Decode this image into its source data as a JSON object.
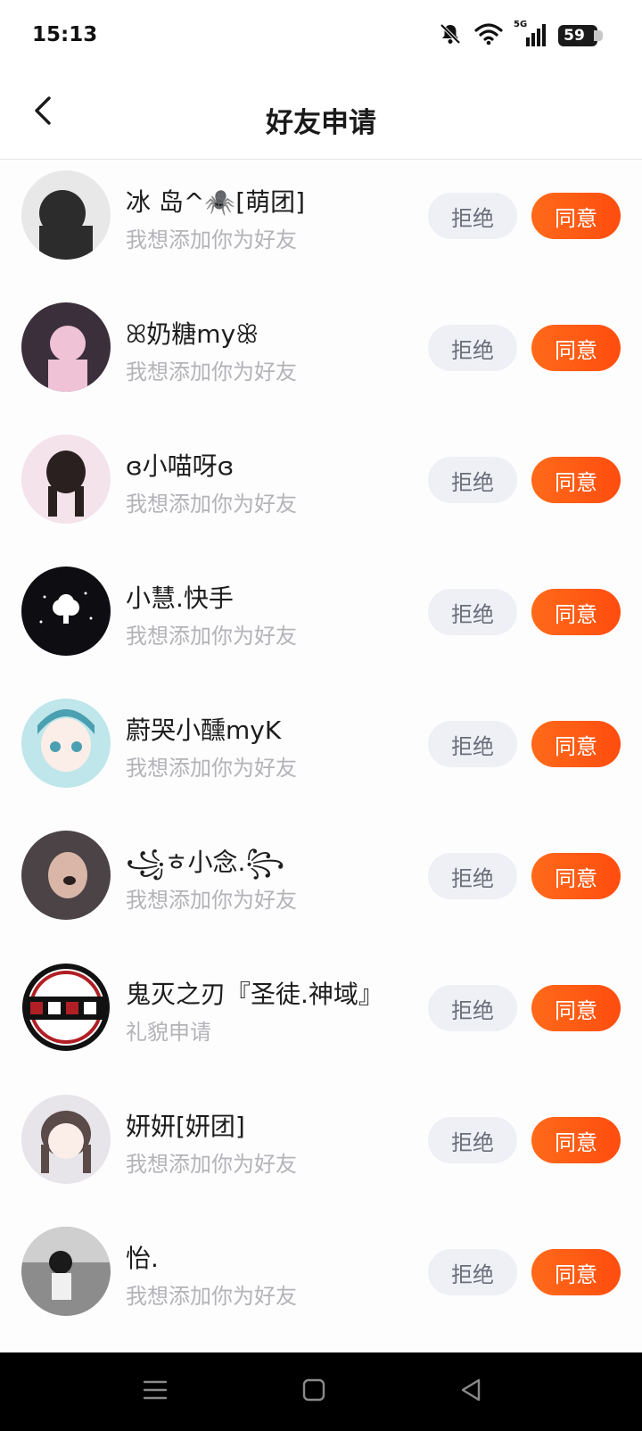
{
  "status": {
    "time": "15:13",
    "network_label": "5G",
    "battery_level": "59"
  },
  "nav": {
    "title": "好友申请"
  },
  "buttons": {
    "reject_label": "拒绝",
    "accept_label": "同意"
  },
  "requests": [
    {
      "name": "冰  岛^🕷️[萌团]",
      "message": "我想添加你为好友",
      "avatar_colors": [
        "#2c2c2c",
        "#e8e8e8"
      ]
    },
    {
      "name": "ꕤ奶糖myꕥ",
      "message": "我想添加你为好友",
      "avatar_colors": [
        "#3a2f3a",
        "#f0c2d6"
      ]
    },
    {
      "name": "ɞ小喵呀ɞ",
      "message": "我想添加你为好友",
      "avatar_colors": [
        "#f4e3ea",
        "#2a2020"
      ]
    },
    {
      "name": "小慧.快手",
      "message": "我想添加你为好友",
      "avatar_colors": [
        "#0e0e12",
        "#ffffff"
      ]
    },
    {
      "name": "蔚哭小醺myK",
      "message": "我想添加你为好友",
      "avatar_colors": [
        "#bfe6ea",
        "#4a9fb0"
      ]
    },
    {
      "name": "꧁ㅎ小念.꧂",
      "message": "我想添加你为好友",
      "avatar_colors": [
        "#4b4346",
        "#d9b6a8"
      ]
    },
    {
      "name": "鬼灭之刃『圣徒.神域』",
      "message": "礼貌申请",
      "avatar_colors": [
        "#ffffff",
        "#b01f24"
      ]
    },
    {
      "name": "妍妍[妍团]",
      "message": "我想添加你为好友",
      "avatar_colors": [
        "#e7e4ea",
        "#5a4a48"
      ]
    },
    {
      "name": "怡.",
      "message": "我想添加你为好友",
      "avatar_colors": [
        "#8c8c8c",
        "#f0f0f0"
      ]
    }
  ],
  "colors": {
    "accent": "#ff5a14",
    "reject_bg": "#eef0f5",
    "secondary_text": "#b3b3b8"
  },
  "icons": {
    "back": "chevron-left-icon",
    "silent": "bell-off-icon",
    "wifi": "wifi-icon",
    "signal": "signal-bars-icon",
    "battery": "battery-icon",
    "nav_menu": "menu-icon",
    "nav_home": "home-square-icon",
    "nav_back": "triangle-back-icon"
  }
}
